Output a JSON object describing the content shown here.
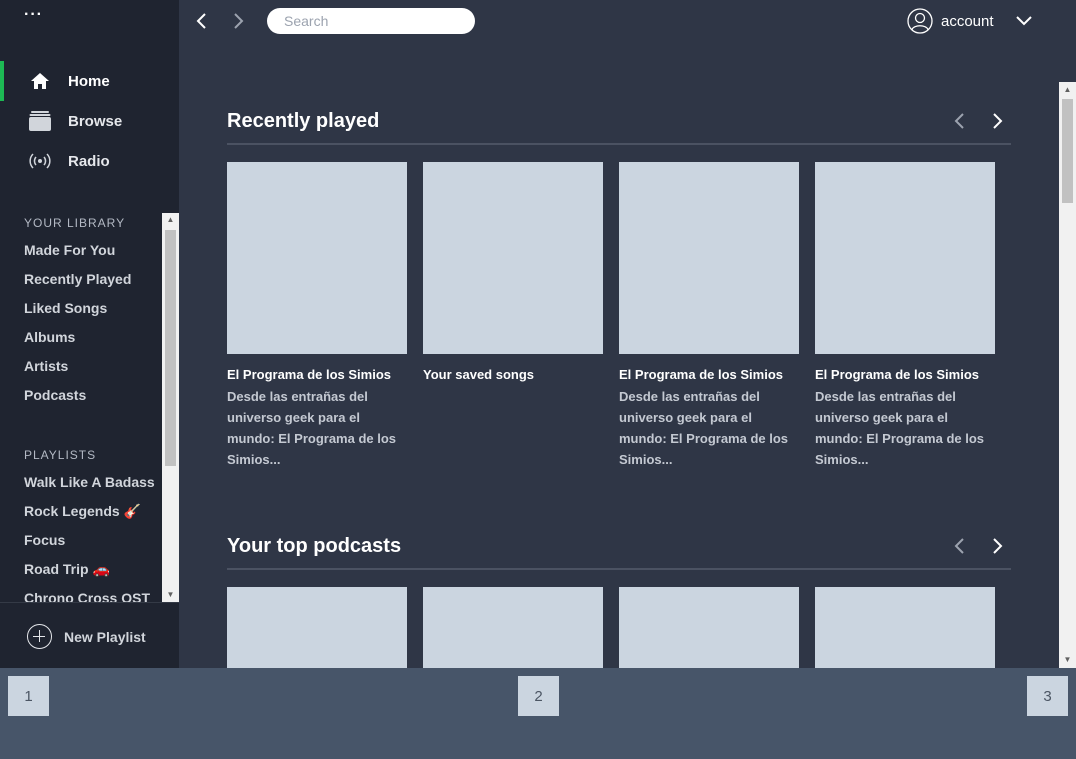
{
  "sidebar": {
    "menu_dots": "···",
    "nav": [
      {
        "label": "Home",
        "icon": "home-icon",
        "active": true
      },
      {
        "label": "Browse",
        "icon": "browse-icon",
        "active": false
      },
      {
        "label": "Radio",
        "icon": "radio-icon",
        "active": false
      }
    ],
    "library_heading": "YOUR LIBRARY",
    "library_items": [
      "Made For You",
      "Recently Played",
      "Liked Songs",
      "Albums",
      "Artists",
      "Podcasts"
    ],
    "playlists_heading": "PLAYLISTS",
    "playlists": [
      "Walk Like A Badass",
      "Rock Legends 🎸",
      "Focus",
      "Road Trip 🚗",
      "Chrono Cross OST"
    ],
    "new_playlist_label": "New Playlist"
  },
  "topbar": {
    "search_placeholder": "Search",
    "account_label": "account"
  },
  "shelves": [
    {
      "title": "Recently played",
      "cards": [
        {
          "title": "El Programa de los Simios",
          "description": "Desde las entrañas del universo geek para el mundo: El Programa de los Simios..."
        },
        {
          "title": "Your saved songs",
          "description": ""
        },
        {
          "title": "El Programa de los Simios",
          "description": "Desde las entrañas del universo geek para el mundo: El Programa de los Simios..."
        },
        {
          "title": "El Programa de los Simios",
          "description": "Desde las entrañas del universo geek para el mundo: El Programa de los Simios..."
        }
      ]
    },
    {
      "title": "Your top podcasts",
      "cards": [
        {},
        {},
        {},
        {}
      ]
    }
  ],
  "pager": [
    "1",
    "2",
    "3"
  ],
  "colors": {
    "sidebar_bg": "#1f2430",
    "main_bg": "#2f3646",
    "accent": "#1db954",
    "placeholder_cover": "#cbd5e0",
    "bottom_bg": "#475569"
  }
}
